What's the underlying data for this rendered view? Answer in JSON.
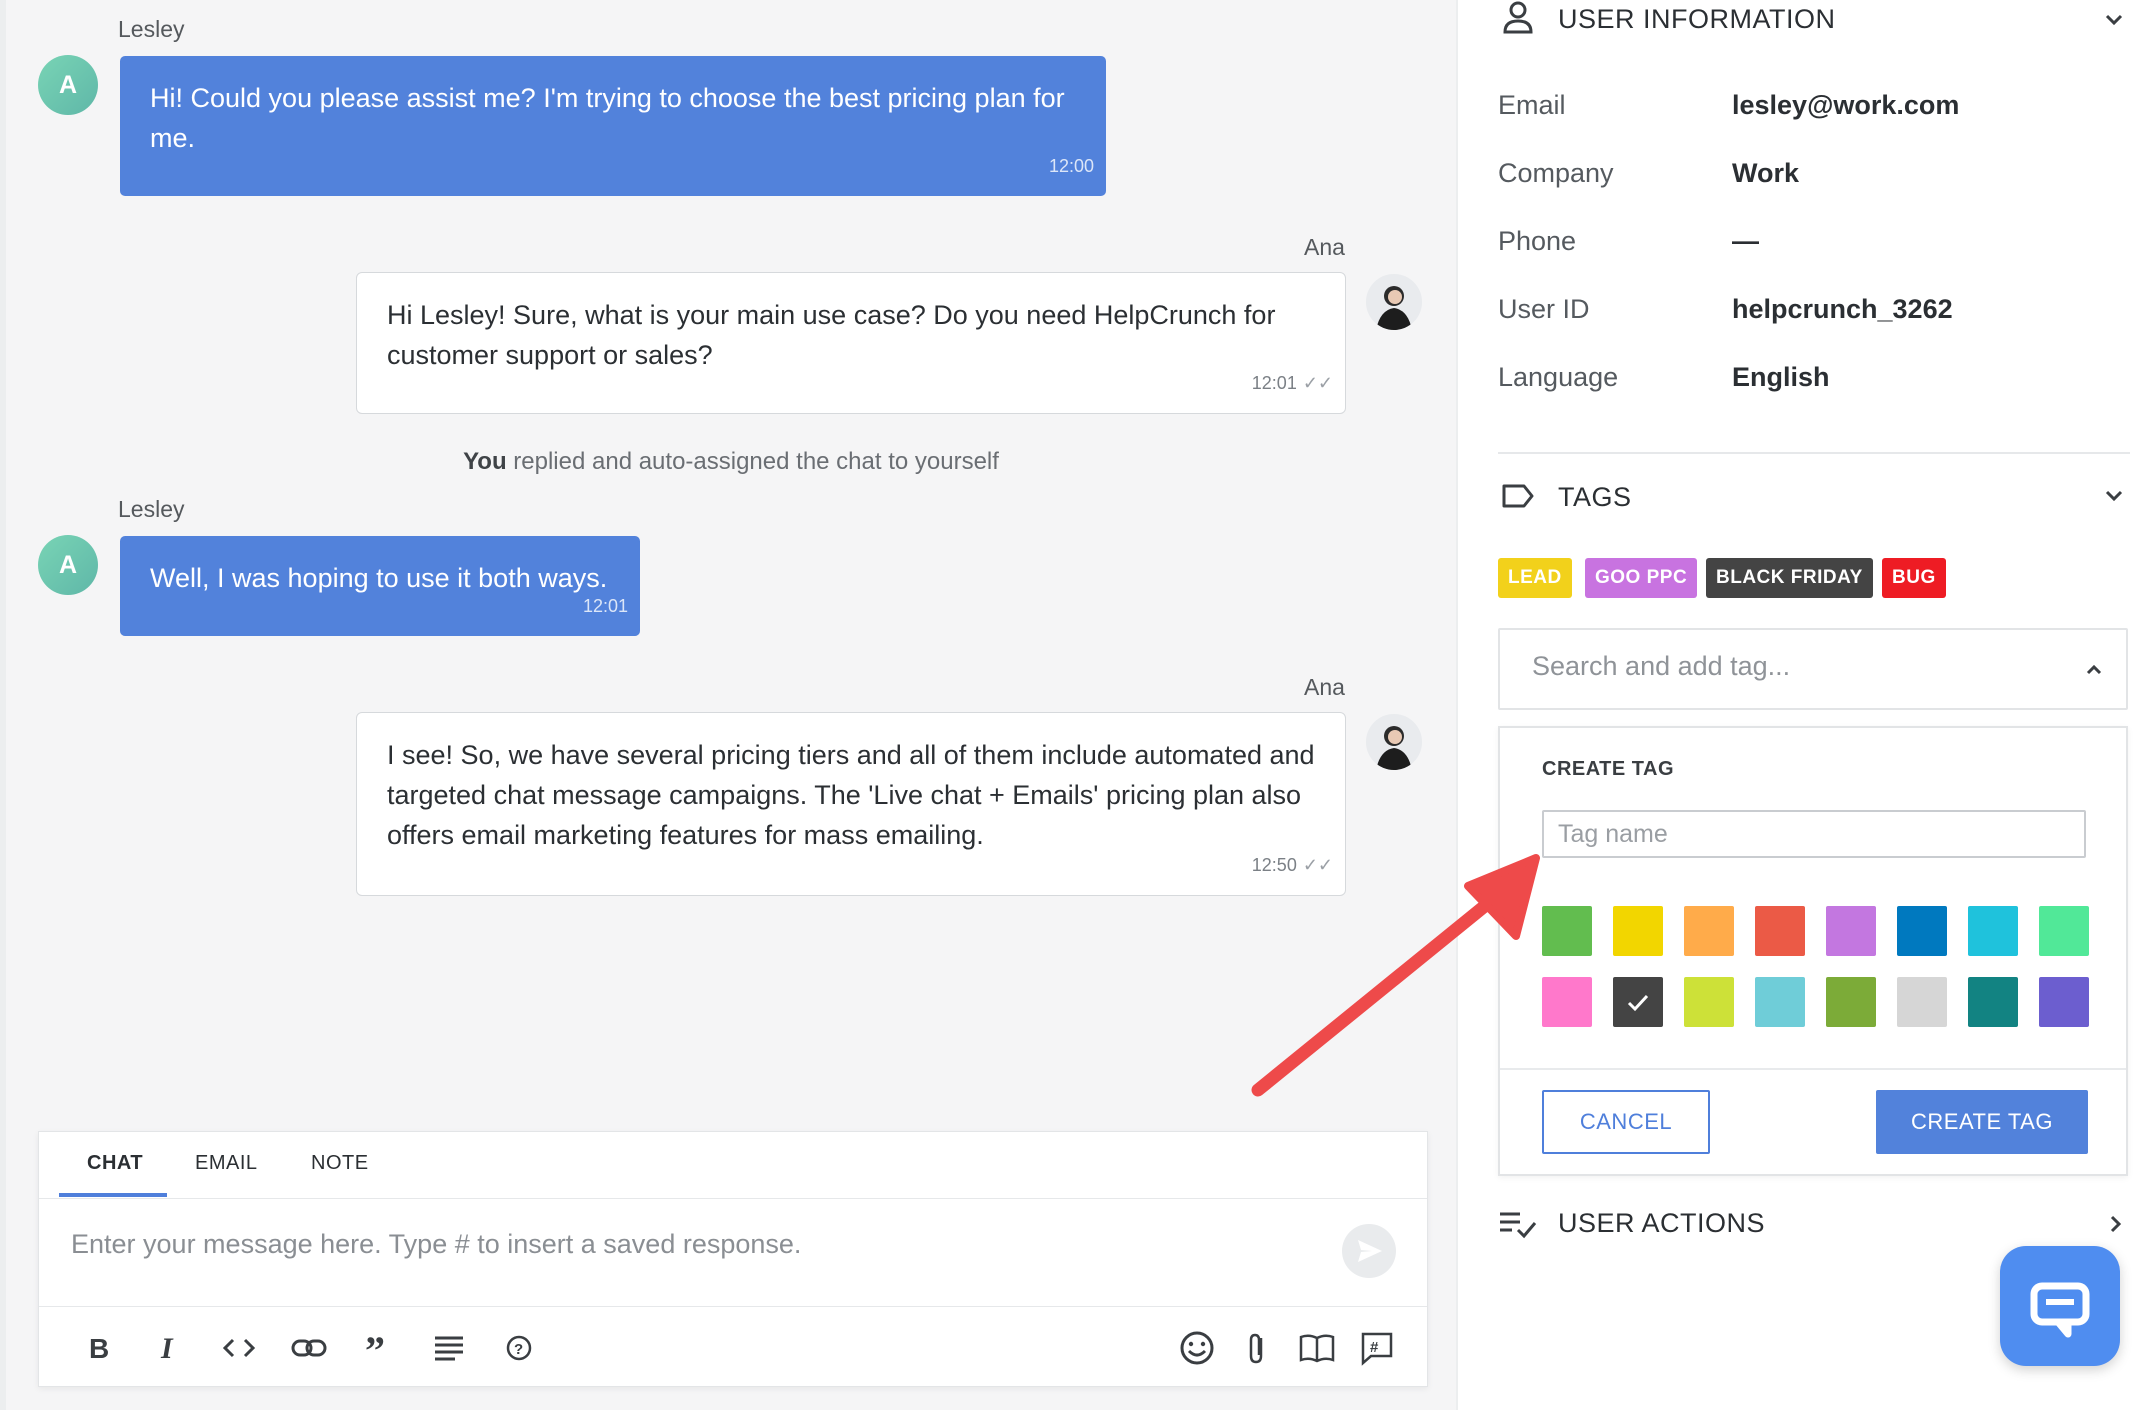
{
  "chat": {
    "messages": [
      {
        "sender": "Lesley",
        "avatar_letter": "A",
        "text": "Hi! Could you please assist me? I'm trying to choose the best pricing plan for me.",
        "time": "12:00",
        "direction": "in"
      },
      {
        "sender": "Ana",
        "text": "Hi Lesley! Sure, what is your main use case? Do you need HelpCrunch for customer support or sales?",
        "time": "12:01",
        "direction": "out"
      },
      {
        "sender": "Lesley",
        "avatar_letter": "A",
        "text": "Well, I was hoping to use it both ways.",
        "time": "12:01",
        "direction": "in"
      },
      {
        "sender": "Ana",
        "text": "I see! So, we have several pricing tiers and all of them include automated and targeted chat message campaigns. The 'Live chat + Emails' pricing plan also offers email marketing features for mass emailing.",
        "time": "12:50",
        "direction": "out"
      }
    ],
    "system_message": {
      "bold": "You",
      "rest": " replied and auto-assigned the chat to yourself"
    }
  },
  "composer": {
    "tabs": [
      "CHAT",
      "EMAIL",
      "NOTE"
    ],
    "active_tab": "CHAT",
    "placeholder": "Enter your message here. Type # to insert a saved response.",
    "toolbar_icons": [
      "bold-icon",
      "italic-icon",
      "code-icon",
      "link-icon",
      "quote-icon",
      "list-icon",
      "help-icon"
    ],
    "right_icons": [
      "emoji-icon",
      "attachment-icon",
      "knowledge-base-icon",
      "saved-response-icon"
    ]
  },
  "sidebar": {
    "user_info": {
      "title": "USER INFORMATION",
      "fields": [
        {
          "label": "Email",
          "value": "lesley@work.com"
        },
        {
          "label": "Company",
          "value": "Work"
        },
        {
          "label": "Phone",
          "value": "—"
        },
        {
          "label": "User ID",
          "value": "helpcrunch_3262"
        },
        {
          "label": "Language",
          "value": "English"
        }
      ]
    },
    "tags": {
      "title": "TAGS",
      "items": [
        {
          "label": "LEAD",
          "color": "#f2d11b"
        },
        {
          "label": "GOO PPC",
          "color": "#c873e0"
        },
        {
          "label": "BLACK FRIDAY",
          "color": "#444444"
        },
        {
          "label": "BUG",
          "color": "#ee1c24"
        }
      ],
      "search_placeholder": "Search and add tag...",
      "create": {
        "title": "CREATE TAG",
        "name_placeholder": "Tag name",
        "colors": [
          "#62bd4f",
          "#f2d600",
          "#ffab4a",
          "#eb5a46",
          "#c377e0",
          "#0079bf",
          "#1fc2dc",
          "#51e898",
          "#ff78cb",
          "#444444",
          "#cde138",
          "#6fcdd8",
          "#7cab38",
          "#d6d6d6",
          "#128382",
          "#6c5ecf"
        ],
        "selected_color": "#444444",
        "cancel_label": "CANCEL",
        "submit_label": "CREATE TAG"
      }
    },
    "user_actions": {
      "title": "USER ACTIONS"
    }
  },
  "colors": {
    "accent": "#5282db",
    "arrow": "#ee4a4a"
  }
}
